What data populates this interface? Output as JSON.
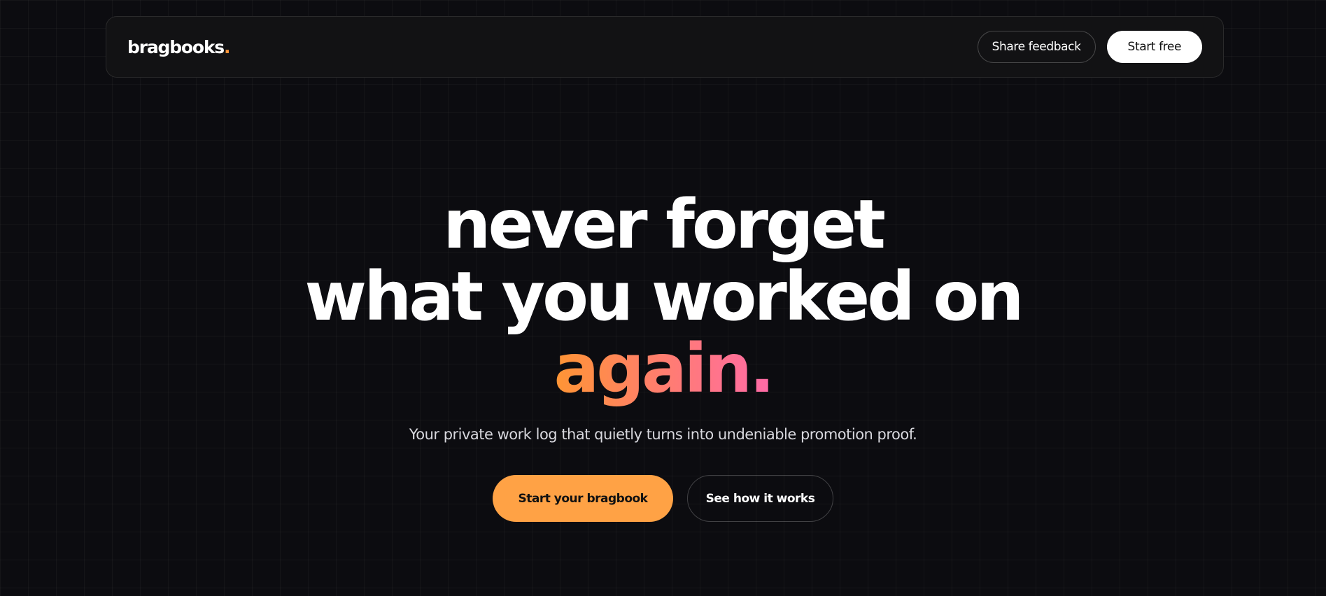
{
  "nav": {
    "logo_text": "bragbooks",
    "logo_dot": ".",
    "share_feedback_label": "Share feedback",
    "start_free_label": "Start free"
  },
  "hero": {
    "headline_line1": "never forget",
    "headline_line2": "what you worked on",
    "headline_accent": "again.",
    "subtitle": "Your private work log that quietly turns into undeniable promotion proof.",
    "primary_cta_label": "Start your bragbook",
    "secondary_cta_label": "See how it works"
  },
  "colors": {
    "background": "#0c0c10",
    "accent_orange": "#ffa245",
    "accent_gradient_start": "#ff9534",
    "accent_gradient_end": "#ff6aa8",
    "text_primary": "#ffffff"
  }
}
